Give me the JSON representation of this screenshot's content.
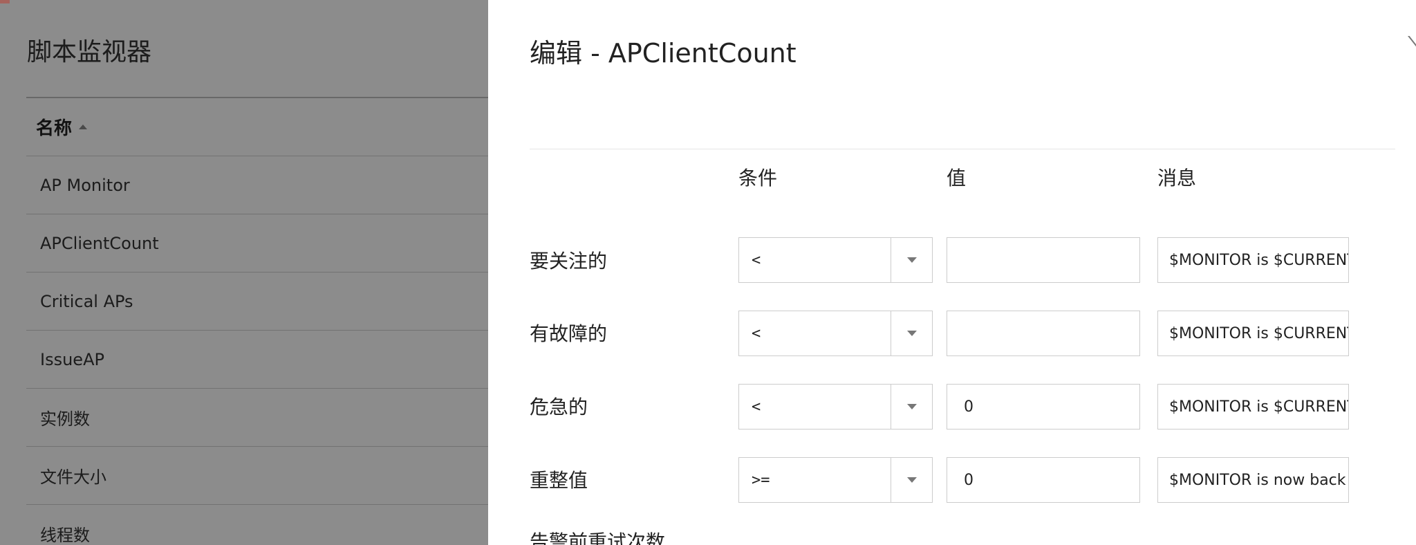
{
  "background": {
    "title": "脚本监视器",
    "column_header": "名称",
    "rows": [
      "AP Monitor",
      "APClientCount",
      "Critical APs",
      "IssueAP",
      "实例数",
      "文件大小",
      "线程数"
    ]
  },
  "panel": {
    "title": "编辑 - APClientCount",
    "columns": {
      "condition": "条件",
      "value": "值",
      "message": "消息"
    },
    "rows": [
      {
        "label": "要关注的",
        "condition": "<",
        "value": "",
        "message": "$MONITOR is $CURRENT"
      },
      {
        "label": "有故障的",
        "condition": "<",
        "value": "",
        "message": "$MONITOR is $CURRENT"
      },
      {
        "label": "危急的",
        "condition": "<",
        "value": "0",
        "message": "$MONITOR is $CURRENT"
      },
      {
        "label": "重整值",
        "condition": ">=",
        "value": "0",
        "message": "$MONITOR is now back"
      }
    ],
    "retry_label": "告警前重试次数"
  },
  "icons": {
    "close": "close-icon",
    "sort": "sort-asc-icon",
    "dropdown": "chevron-down-icon"
  }
}
